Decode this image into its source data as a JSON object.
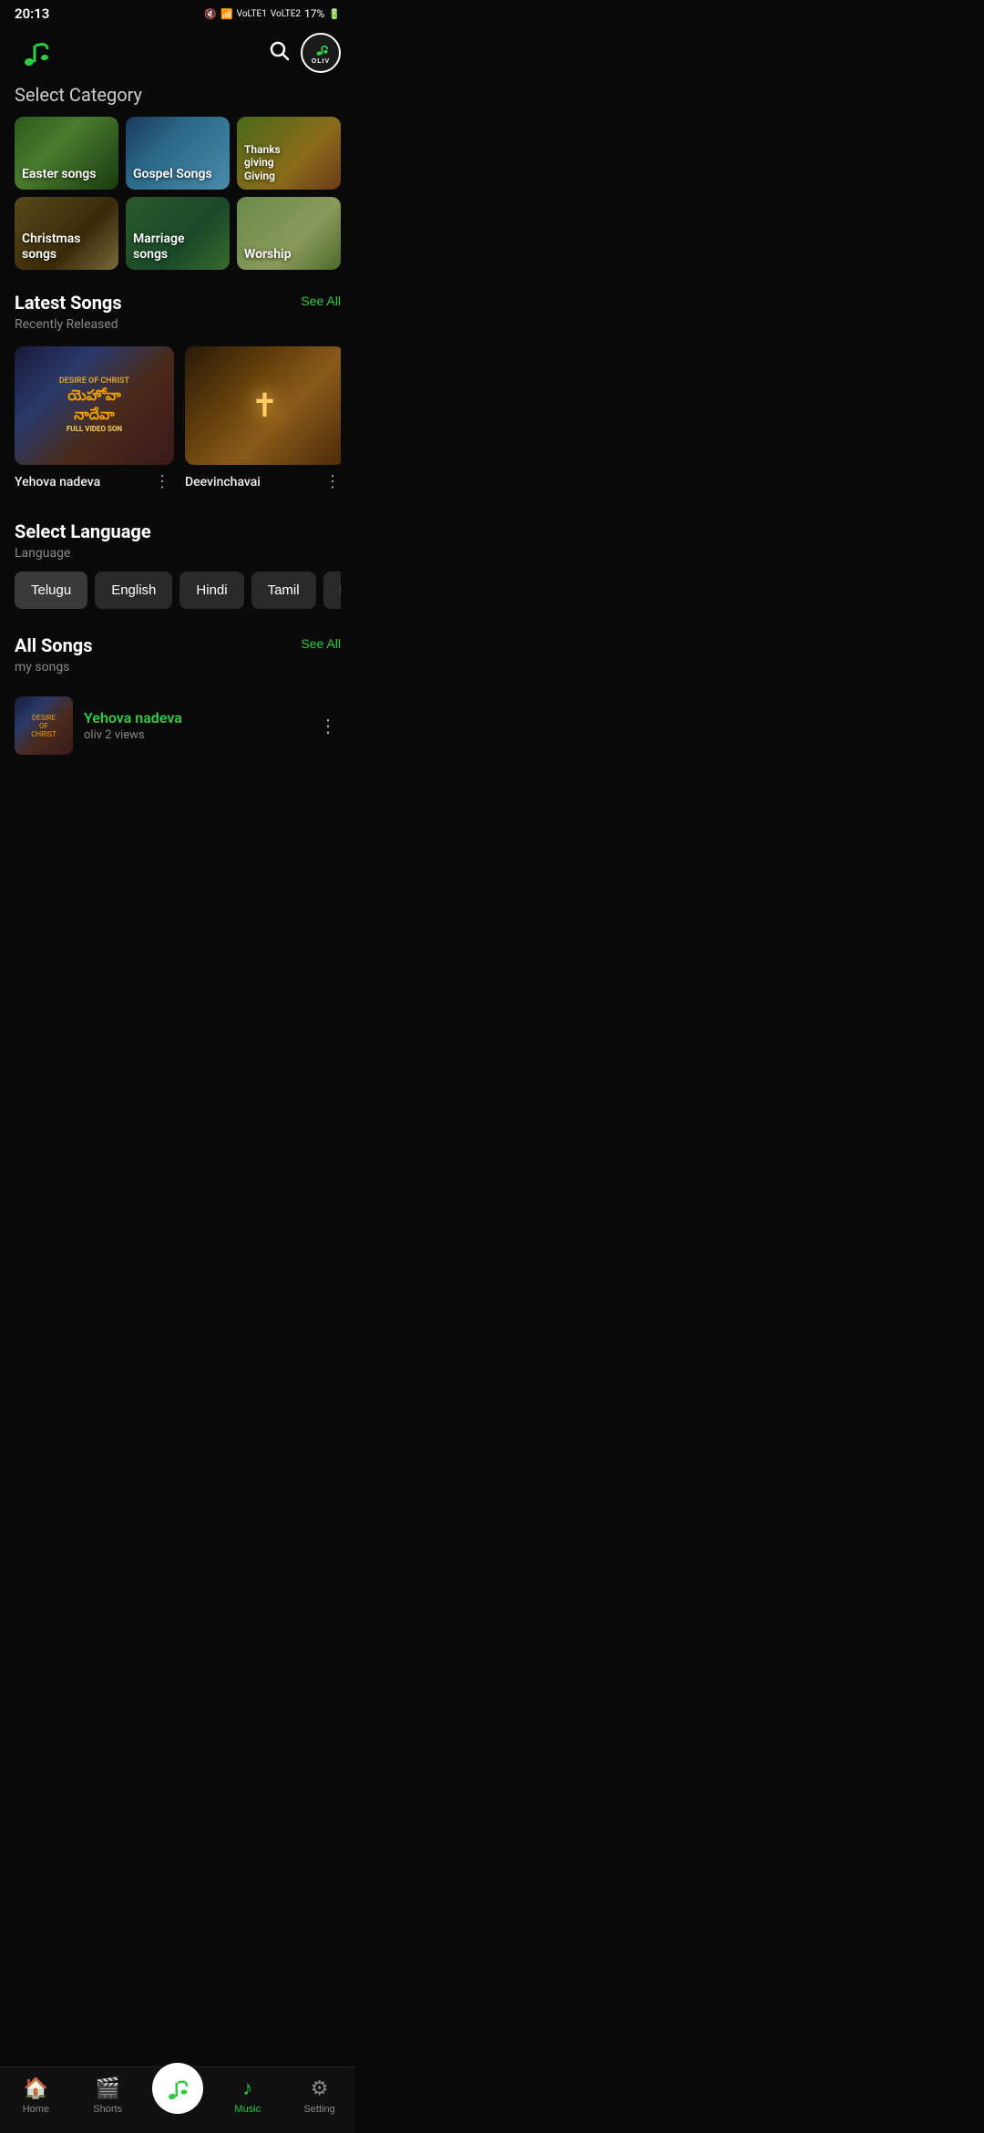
{
  "statusBar": {
    "time": "20:13",
    "battery": "17%"
  },
  "header": {
    "appName": "OLIV"
  },
  "selectCategory": {
    "title": "Select Category",
    "categories": [
      {
        "id": "easter",
        "label": "Easter songs",
        "cssClass": "cat-easter"
      },
      {
        "id": "gospel",
        "label": "Gospel Songs",
        "cssClass": "cat-gospel"
      },
      {
        "id": "thanksgiving",
        "label": "Thanks\ngiving Giving",
        "cssClass": "cat-thanksgiving"
      },
      {
        "id": "christmas",
        "label": "Christmas songs",
        "cssClass": "cat-christmas"
      },
      {
        "id": "marriage",
        "label": "Marriage songs",
        "cssClass": "cat-marriage"
      },
      {
        "id": "worship",
        "label": "Worship",
        "cssClass": "cat-worship"
      }
    ]
  },
  "latestSongs": {
    "title": "Latest Songs",
    "subtitle": "Recently Released",
    "seeAllLabel": "See All",
    "songs": [
      {
        "id": 1,
        "name": "Yehova nadeva",
        "type": "thumb1"
      },
      {
        "id": 2,
        "name": "Deevinchavai",
        "type": "thumb2"
      }
    ]
  },
  "selectLanguage": {
    "title": "Select Language",
    "subtitle": "Language",
    "languages": [
      {
        "id": "telugu",
        "label": "Telugu"
      },
      {
        "id": "english",
        "label": "English"
      },
      {
        "id": "hindi",
        "label": "Hindi"
      },
      {
        "id": "tamil",
        "label": "Tamil"
      },
      {
        "id": "malayalam",
        "label": "Malayala..."
      }
    ]
  },
  "allSongs": {
    "title": "All Songs",
    "subtitle": "my songs",
    "seeAllLabel": "See All",
    "songs": [
      {
        "id": 1,
        "name": "Yehova nadeva",
        "meta": "oliv 2 views"
      }
    ]
  },
  "bottomNav": {
    "items": [
      {
        "id": "home",
        "label": "Home",
        "icon": "🏠",
        "active": false
      },
      {
        "id": "shorts",
        "label": "Shorts",
        "icon": "🎬",
        "active": false
      },
      {
        "id": "music",
        "label": "Music",
        "icon": "♪",
        "active": true
      },
      {
        "id": "setting",
        "label": "Setting",
        "icon": "⚙",
        "active": false
      }
    ]
  }
}
